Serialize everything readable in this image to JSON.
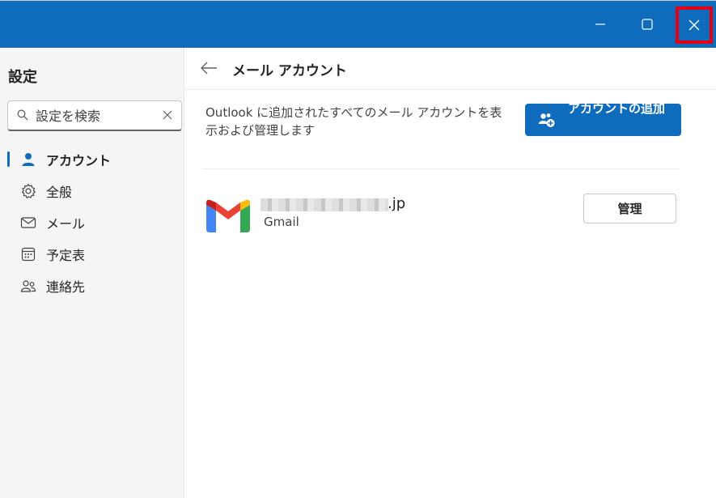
{
  "window": {
    "minimize_icon": "minimize-icon",
    "maximize_icon": "maximize-icon",
    "close_icon": "close-icon",
    "titlebar_color": "#0f6cbd",
    "highlight_color": "#e60012"
  },
  "sidebar": {
    "title": "設定",
    "search": {
      "placeholder": "設定を検索",
      "value": ""
    },
    "items": [
      {
        "label": "アカウント",
        "icon": "person-icon",
        "active": true
      },
      {
        "label": "全般",
        "icon": "gear-icon",
        "active": false
      },
      {
        "label": "メール",
        "icon": "mail-icon",
        "active": false
      },
      {
        "label": "予定表",
        "icon": "calendar-icon",
        "active": false
      },
      {
        "label": "連絡先",
        "icon": "people-icon",
        "active": false
      }
    ]
  },
  "main": {
    "title": "メール アカウント",
    "description": "Outlook に追加されたすべてのメール アカウントを表示および管理します",
    "add_account_label": "アカウントの追加",
    "accounts": [
      {
        "email_suffix": ".jp",
        "type": "Gmail",
        "manage_label": "管理"
      }
    ]
  }
}
